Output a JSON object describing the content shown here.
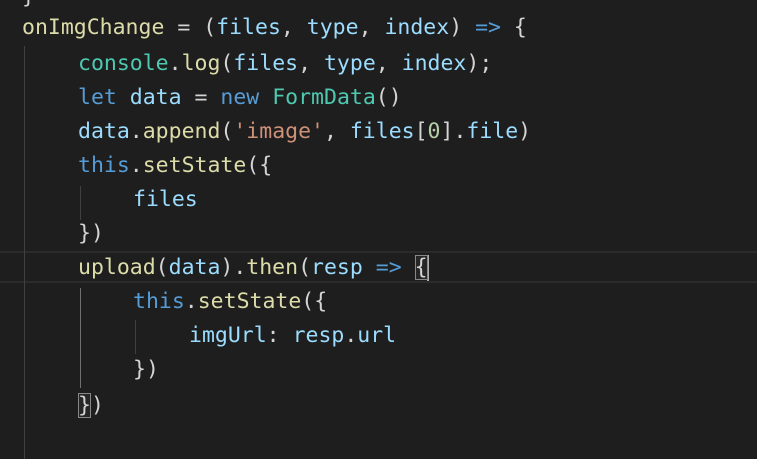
{
  "editor": {
    "theme": {
      "background": "#1e1e1e",
      "function_color": "#dcdcaa",
      "variable_color": "#9cdcfe",
      "keyword_color": "#569cd6",
      "class_color": "#4ec9b0",
      "string_color": "#ce9178",
      "number_color": "#b5cea8",
      "punctuation_color": "#d4d4d4"
    },
    "lines": [
      {
        "tokens": [
          {
            "text": "}",
            "kind": "punc"
          }
        ]
      },
      {
        "tokens": [
          {
            "text": "onImgChange",
            "kind": "fn"
          },
          {
            "text": " = (",
            "kind": "punc"
          },
          {
            "text": "files",
            "kind": "var"
          },
          {
            "text": ", ",
            "kind": "punc"
          },
          {
            "text": "type",
            "kind": "var"
          },
          {
            "text": ", ",
            "kind": "punc"
          },
          {
            "text": "index",
            "kind": "var"
          },
          {
            "text": ") ",
            "kind": "punc"
          },
          {
            "text": "=>",
            "kind": "kw"
          },
          {
            "text": " {",
            "kind": "punc"
          }
        ]
      },
      {
        "tokens": [
          {
            "text": "console",
            "kind": "class"
          },
          {
            "text": ".",
            "kind": "punc"
          },
          {
            "text": "log",
            "kind": "fn"
          },
          {
            "text": "(",
            "kind": "punc"
          },
          {
            "text": "files",
            "kind": "var"
          },
          {
            "text": ", ",
            "kind": "punc"
          },
          {
            "text": "type",
            "kind": "var"
          },
          {
            "text": ", ",
            "kind": "punc"
          },
          {
            "text": "index",
            "kind": "var"
          },
          {
            "text": ");",
            "kind": "punc"
          }
        ]
      },
      {
        "tokens": [
          {
            "text": "let",
            "kind": "kw"
          },
          {
            "text": " ",
            "kind": "punc"
          },
          {
            "text": "data",
            "kind": "var"
          },
          {
            "text": " = ",
            "kind": "punc"
          },
          {
            "text": "new",
            "kind": "kw"
          },
          {
            "text": " ",
            "kind": "punc"
          },
          {
            "text": "FormData",
            "kind": "class"
          },
          {
            "text": "()",
            "kind": "punc"
          }
        ]
      },
      {
        "tokens": [
          {
            "text": "data",
            "kind": "var"
          },
          {
            "text": ".",
            "kind": "punc"
          },
          {
            "text": "append",
            "kind": "fn"
          },
          {
            "text": "(",
            "kind": "punc"
          },
          {
            "text": "'image'",
            "kind": "str"
          },
          {
            "text": ", ",
            "kind": "punc"
          },
          {
            "text": "files",
            "kind": "var"
          },
          {
            "text": "[",
            "kind": "punc"
          },
          {
            "text": "0",
            "kind": "num"
          },
          {
            "text": "].",
            "kind": "punc"
          },
          {
            "text": "file",
            "kind": "var"
          },
          {
            "text": ")",
            "kind": "punc"
          }
        ]
      },
      {
        "tokens": [
          {
            "text": "this",
            "kind": "kw"
          },
          {
            "text": ".",
            "kind": "punc"
          },
          {
            "text": "setState",
            "kind": "fn"
          },
          {
            "text": "({",
            "kind": "punc"
          }
        ]
      },
      {
        "tokens": [
          {
            "text": "files",
            "kind": "var"
          }
        ]
      },
      {
        "tokens": [
          {
            "text": "})",
            "kind": "punc"
          }
        ]
      },
      {
        "tokens": [
          {
            "text": "upload",
            "kind": "fn"
          },
          {
            "text": "(",
            "kind": "punc"
          },
          {
            "text": "data",
            "kind": "var"
          },
          {
            "text": ").",
            "kind": "punc"
          },
          {
            "text": "then",
            "kind": "fn"
          },
          {
            "text": "(",
            "kind": "punc"
          },
          {
            "text": "resp",
            "kind": "var"
          },
          {
            "text": " ",
            "kind": "punc"
          },
          {
            "text": "=>",
            "kind": "kw"
          },
          {
            "text": " ",
            "kind": "punc"
          },
          {
            "text": "{",
            "kind": "punc",
            "match": true
          },
          {
            "text": "",
            "kind": "cursor"
          }
        ]
      },
      {
        "tokens": [
          {
            "text": "this",
            "kind": "kw"
          },
          {
            "text": ".",
            "kind": "punc"
          },
          {
            "text": "setState",
            "kind": "fn"
          },
          {
            "text": "({",
            "kind": "punc"
          }
        ]
      },
      {
        "tokens": [
          {
            "text": "imgUrl",
            "kind": "var"
          },
          {
            "text": ": ",
            "kind": "punc"
          },
          {
            "text": "resp",
            "kind": "var"
          },
          {
            "text": ".",
            "kind": "punc"
          },
          {
            "text": "url",
            "kind": "var"
          }
        ]
      },
      {
        "tokens": [
          {
            "text": "})",
            "kind": "punc"
          }
        ]
      },
      {
        "tokens": [
          {
            "text": "}",
            "kind": "punc",
            "match": true
          },
          {
            "text": ")",
            "kind": "punc"
          }
        ]
      }
    ]
  }
}
